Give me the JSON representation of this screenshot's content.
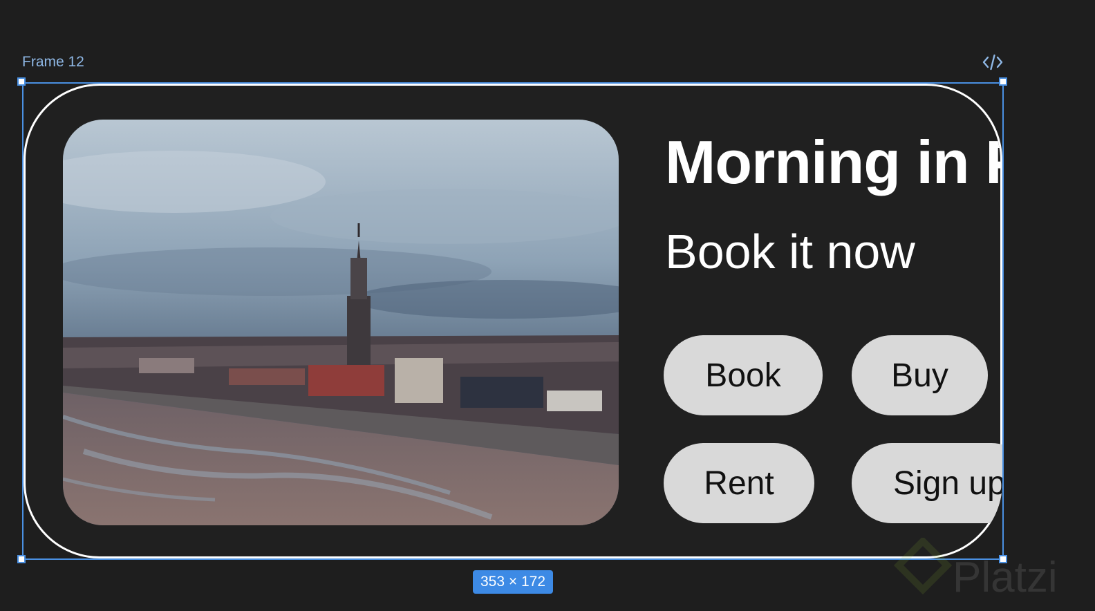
{
  "frame": {
    "label": "Frame 12",
    "size_badge": "353 × 172"
  },
  "card": {
    "title": "Morning in P",
    "subtitle": "Book it now",
    "image_description_icon": "photo",
    "buttons": {
      "book": "Book",
      "buy": "Buy",
      "rent": "Rent",
      "signup": "Sign up"
    }
  },
  "watermark": {
    "text": "Platzi"
  },
  "icons": {
    "code": "code-icon"
  },
  "colors": {
    "background": "#1e1e1e",
    "selection": "#4a90e2",
    "button": "#d9d9d9",
    "badge": "#3d8ae5"
  }
}
